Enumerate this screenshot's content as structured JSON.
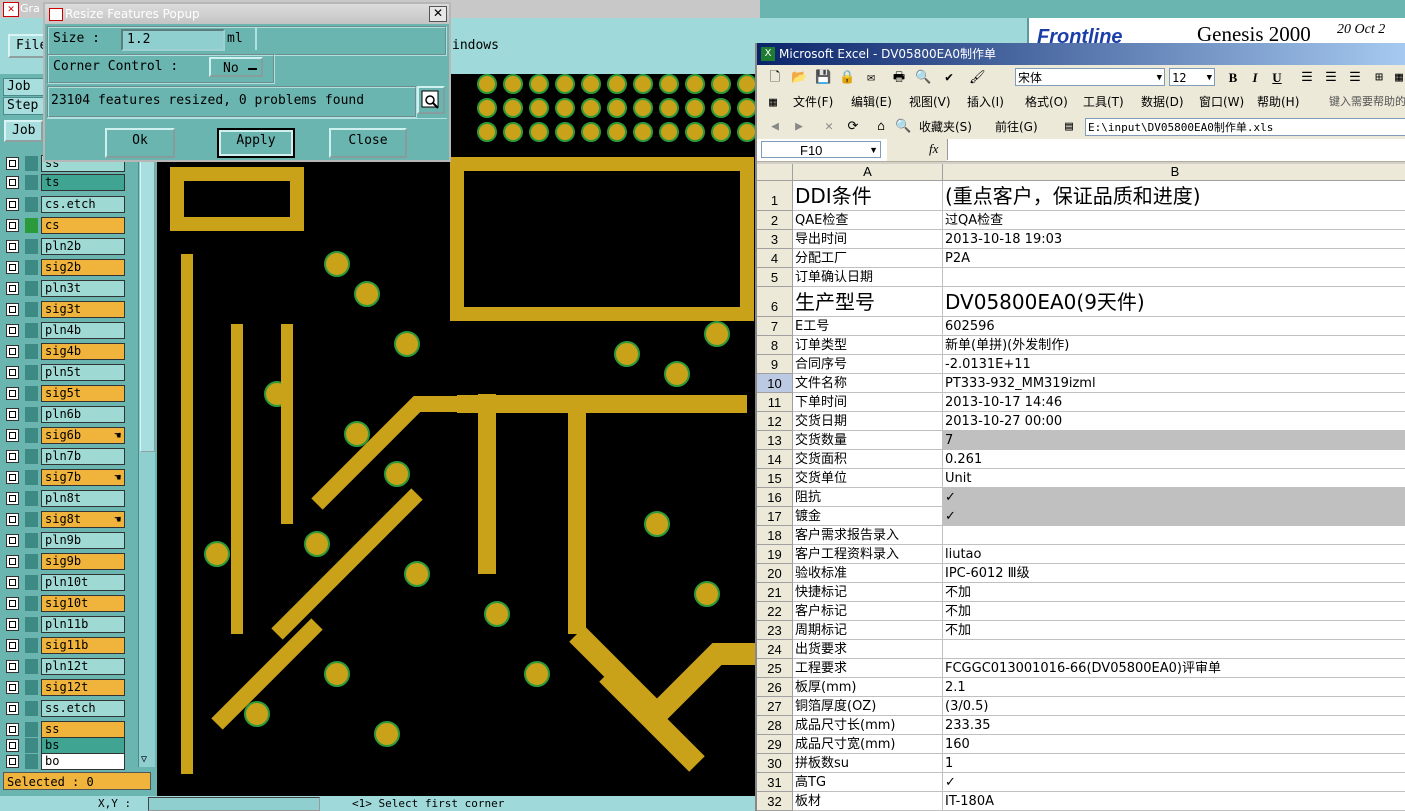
{
  "genesis": {
    "title": "Gra",
    "file_menu": "File",
    "windows_menu": "indows",
    "job_label": "Job",
    "step_label": "Step",
    "job_button": "Job",
    "selected_status": "Selected : 0",
    "bottom_prompt": "<1>  Select first corner",
    "xy_label": "X,Y :",
    "hand_glyph": "☚",
    "layers": [
      {
        "name": "ss",
        "color": "t-green"
      },
      {
        "name": "ts",
        "color": "t-teal"
      },
      {
        "name": "cs.etch",
        "color": "t-green"
      },
      {
        "name": "cs",
        "color": "t-orange"
      },
      {
        "name": "pln2b",
        "color": "t-green"
      },
      {
        "name": "sig2b",
        "color": "t-orange"
      },
      {
        "name": "pln3t",
        "color": "t-green"
      },
      {
        "name": "sig3t",
        "color": "t-orange"
      },
      {
        "name": "pln4b",
        "color": "t-green"
      },
      {
        "name": "sig4b",
        "color": "t-orange"
      },
      {
        "name": "pln5t",
        "color": "t-green"
      },
      {
        "name": "sig5t",
        "color": "t-orange"
      },
      {
        "name": "pln6b",
        "color": "t-green"
      },
      {
        "name": "sig6b",
        "color": "t-orange",
        "hand": true
      },
      {
        "name": "pln7b",
        "color": "t-green"
      },
      {
        "name": "sig7b",
        "color": "t-orange",
        "hand": true
      },
      {
        "name": "pln8t",
        "color": "t-green"
      },
      {
        "name": "sig8t",
        "color": "t-orange",
        "hand": true
      },
      {
        "name": "pln9b",
        "color": "t-green"
      },
      {
        "name": "sig9b",
        "color": "t-orange"
      },
      {
        "name": "pln10t",
        "color": "t-green"
      },
      {
        "name": "sig10t",
        "color": "t-orange"
      },
      {
        "name": "pln11b",
        "color": "t-green"
      },
      {
        "name": "sig11b",
        "color": "t-orange"
      },
      {
        "name": "pln12t",
        "color": "t-green"
      },
      {
        "name": "sig12t",
        "color": "t-orange"
      },
      {
        "name": "ss.etch",
        "color": "t-green"
      },
      {
        "name": "ss",
        "color": "t-orange"
      },
      {
        "name": "bs",
        "color": "t-teal"
      },
      {
        "name": "bo",
        "color": "t-white"
      }
    ]
  },
  "popup": {
    "title": "Resize Features Popup",
    "close_glyph": "✕",
    "size_label": "Size :",
    "size_value": "1.2",
    "size_unit": "ml",
    "corner_label": "Corner Control :",
    "corner_value": "No",
    "status": "23104 features resized, 0 problems found",
    "ok_label": "Ok",
    "apply_label": "Apply",
    "close_label": "Close"
  },
  "banner": {
    "brand": "Frontline",
    "product": "Genesis 2000",
    "date": "20 Oct 2"
  },
  "excel": {
    "title": "Microsoft Excel - DV05800EA0制作单",
    "font_name": "宋体",
    "font_size": "12",
    "menus": [
      "文件(F)",
      "编辑(E)",
      "视图(V)",
      "插入(I)",
      "格式(O)",
      "工具(T)",
      "数据(D)",
      "窗口(W)",
      "帮助(H)"
    ],
    "help_placeholder": "键入需要帮助的",
    "favorites": "收藏夹(S)",
    "goto": "前往(G)",
    "address": "E:\\input\\DV05800EA0制作单.xls",
    "name_box": "F10",
    "fx": "fx",
    "col_a": "A",
    "col_b": "B",
    "rows": [
      {
        "n": "1",
        "a": "DDI条件",
        "b": "(重点客户，保证品质和进度)",
        "big": true
      },
      {
        "n": "2",
        "a": "QAE检查",
        "b": "过QA检查"
      },
      {
        "n": "3",
        "a": "导出时间",
        "b": "2013-10-18 19:03"
      },
      {
        "n": "4",
        "a": "分配工厂",
        "b": "P2A"
      },
      {
        "n": "5",
        "a": "订单确认日期",
        "b": ""
      },
      {
        "n": "6",
        "a": "生产型号",
        "b": "DV05800EA0(9天件)",
        "big": true
      },
      {
        "n": "7",
        "a": "E工号",
        "b": "602596"
      },
      {
        "n": "8",
        "a": "订单类型",
        "b": "新单(单拼)(外发制作)"
      },
      {
        "n": "9",
        "a": "合同序号",
        "b": "-2.0131E+11"
      },
      {
        "n": "10",
        "a": "文件名称",
        "b": "PT333-932_MM319izml"
      },
      {
        "n": "11",
        "a": "下单时间",
        "b": "2013-10-17 14:46"
      },
      {
        "n": "12",
        "a": "交货日期",
        "b": "2013-10-27 00:00"
      },
      {
        "n": "13",
        "a": "交货数量",
        "b": "7",
        "gray": true
      },
      {
        "n": "14",
        "a": "交货面积",
        "b": "0.261"
      },
      {
        "n": "15",
        "a": "交货单位",
        "b": "Unit"
      },
      {
        "n": "16",
        "a": "阻抗",
        "b": "✓",
        "gray": true
      },
      {
        "n": "17",
        "a": "镀金",
        "b": "✓",
        "gray": true
      },
      {
        "n": "18",
        "a": "客户需求报告录入",
        "b": ""
      },
      {
        "n": "19",
        "a": "客户工程资料录入",
        "b": "liutao"
      },
      {
        "n": "20",
        "a": "验收标准",
        "b": "IPC-6012 Ⅲ级"
      },
      {
        "n": "21",
        "a": "快捷标记",
        "b": "不加"
      },
      {
        "n": "22",
        "a": "客户标记",
        "b": "不加"
      },
      {
        "n": "23",
        "a": "周期标记",
        "b": "不加"
      },
      {
        "n": "24",
        "a": "出货要求",
        "b": ""
      },
      {
        "n": "25",
        "a": "工程要求",
        "b": "FCGGC013001016-66(DV05800EA0)评审单"
      },
      {
        "n": "26",
        "a": "板厚(mm)",
        "b": "2.1"
      },
      {
        "n": "27",
        "a": "铜箔厚度(OZ)",
        "b": "(3/0.5)"
      },
      {
        "n": "28",
        "a": "成品尺寸长(mm)",
        "b": "233.35"
      },
      {
        "n": "29",
        "a": "成品尺寸宽(mm)",
        "b": "160"
      },
      {
        "n": "30",
        "a": "拼板数su",
        "b": "1"
      },
      {
        "n": "31",
        "a": "高TG",
        "b": "✓"
      },
      {
        "n": "32",
        "a": "板材",
        "b": "IT-180A"
      }
    ]
  }
}
